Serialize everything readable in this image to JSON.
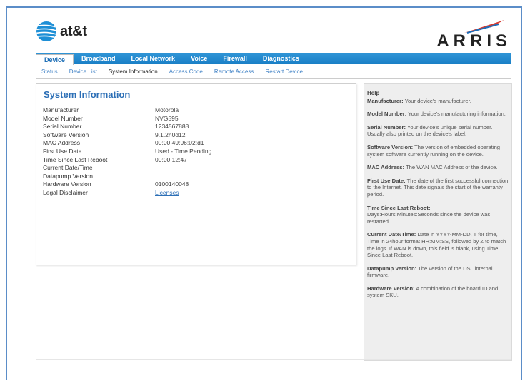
{
  "brand": {
    "att_name": "at&t",
    "arris_name": "ARRIS",
    "accent_color": "#1a7fc6"
  },
  "nav": {
    "tabs": [
      {
        "label": "Device",
        "active": true
      },
      {
        "label": "Broadband",
        "active": false
      },
      {
        "label": "Local Network",
        "active": false
      },
      {
        "label": "Voice",
        "active": false
      },
      {
        "label": "Firewall",
        "active": false
      },
      {
        "label": "Diagnostics",
        "active": false
      }
    ],
    "subtabs": [
      {
        "label": "Status",
        "active": false
      },
      {
        "label": "Device List",
        "active": false
      },
      {
        "label": "System Information",
        "active": true
      },
      {
        "label": "Access Code",
        "active": false
      },
      {
        "label": "Remote Access",
        "active": false
      },
      {
        "label": "Restart Device",
        "active": false
      }
    ]
  },
  "main": {
    "title": "System Information",
    "rows": [
      {
        "label": "Manufacturer",
        "value": "Motorola"
      },
      {
        "label": "Model Number",
        "value": "NVG595"
      },
      {
        "label": "Serial Number",
        "value": "1234567888"
      },
      {
        "label": "Software Version",
        "value": "9.1.2h0d12"
      },
      {
        "label": "MAC Address",
        "value": "00:00:49:96:02:d1"
      },
      {
        "label": "First Use Date",
        "value": "Used - Time Pending"
      },
      {
        "label": "Time Since Last Reboot",
        "value": "00:00:12:47"
      },
      {
        "label": "Current Date/Time",
        "value": ""
      },
      {
        "label": "Datapump Version",
        "value": ""
      },
      {
        "label": "Hardware Version",
        "value": "0100140048"
      },
      {
        "label": "Legal Disclaimer",
        "value": "Licenses",
        "link": true
      }
    ]
  },
  "help": {
    "title": "Help",
    "items": [
      {
        "term": "Manufacturer:",
        "text": " Your device's manufacturer."
      },
      {
        "term": "Model Number:",
        "text": " Your device's manufacturing information."
      },
      {
        "term": "Serial Number:",
        "text": " Your device's unique serial number. Usually also printed on the device's label."
      },
      {
        "term": "Software Version:",
        "text": " The version of embedded operating system software currently running on the device."
      },
      {
        "term": "MAC Address:",
        "text": " The WAN MAC Address of the device."
      },
      {
        "term": "First Use Date:",
        "text": " The date of the first successful connection to the Internet. This date signals the start of the warranty period."
      },
      {
        "term": "Time Since Last Reboot:",
        "text": "Days:Hours:Minutes:Seconds since the device was restarted.",
        "block": true
      },
      {
        "term": "Current Date/Time:",
        "text": " Date in YYYY-MM-DD, T for time, Time in 24hour format HH:MM:SS, followed by Z to match the logs. If WAN is down, this field is blank, using Time Since Last Reboot."
      },
      {
        "term": "Datapump Version:",
        "text": " The version of the DSL internal firmware."
      },
      {
        "term": "Hardware Version:",
        "text": " A combination of the board ID and system SKU."
      }
    ]
  }
}
